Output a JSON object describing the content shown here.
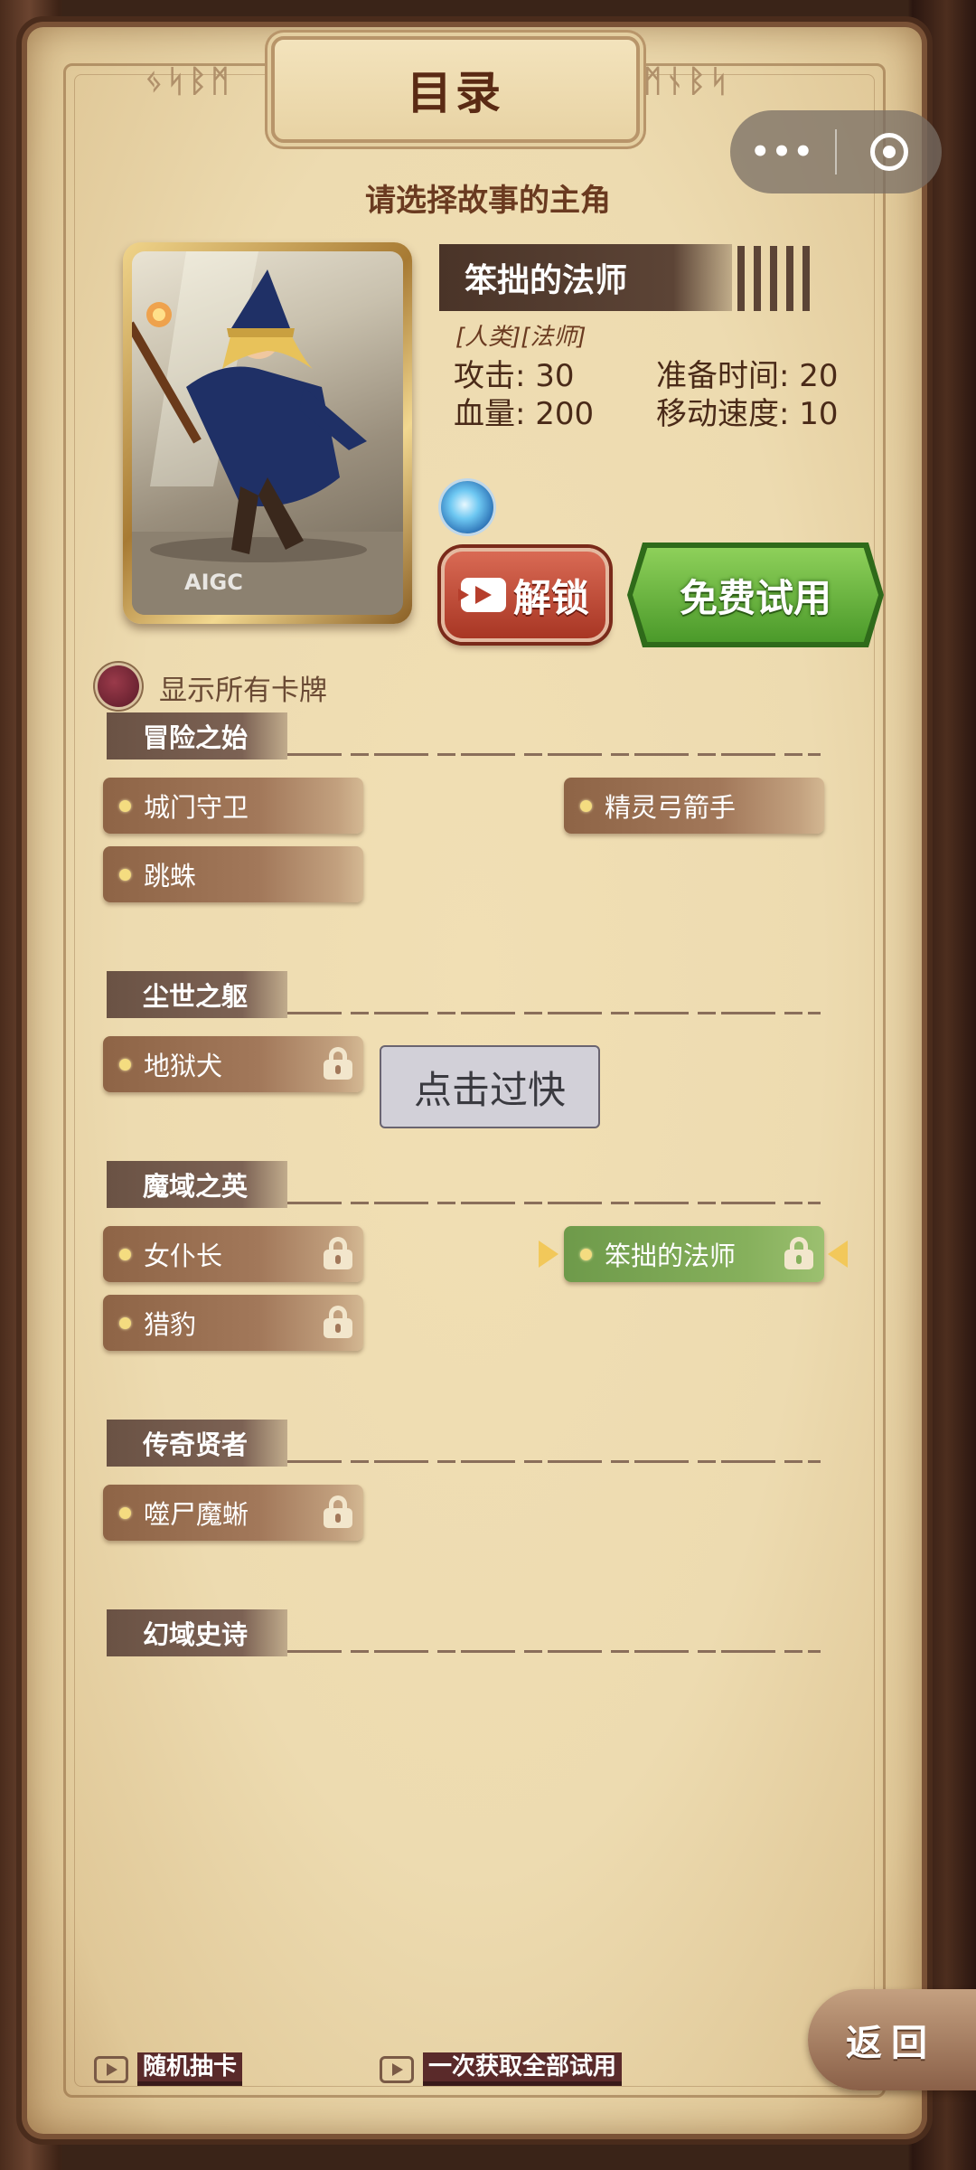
{
  "header": {
    "title": "目录",
    "subtitle": "请选择故事的主角",
    "rune_left": "ᛃᛋᛒᛗ",
    "rune_right": "ᛗᚾᛒᛋ"
  },
  "capsule": {
    "more_icon": "more-dots-icon",
    "close_icon": "target-circle-icon"
  },
  "hero": {
    "name": "笨拙的法师",
    "tags": "[人类][法师]",
    "card_watermark": "AIGC",
    "stats": {
      "attack": "攻击: 30",
      "hp": "血量: 200",
      "prep_time": "准备时间: 20",
      "move_speed": "移动速度: 10"
    }
  },
  "buttons": {
    "unlock": "解锁",
    "free_trial": "免费试用",
    "back": "返回"
  },
  "toggle": {
    "label": "显示所有卡牌",
    "checked": false
  },
  "sections": [
    {
      "title": "冒险之始",
      "items": [
        {
          "label": "城门守卫",
          "locked": false
        },
        {
          "label": "精灵弓箭手",
          "locked": false
        },
        {
          "label": "跳蛛",
          "locked": false
        }
      ]
    },
    {
      "title": "尘世之躯",
      "items": [
        {
          "label": "地狱犬",
          "locked": true
        }
      ]
    },
    {
      "title": "魔域之英",
      "items": [
        {
          "label": "女仆长",
          "locked": true
        },
        {
          "label": "笨拙的法师",
          "locked": true,
          "selected": true
        },
        {
          "label": "猎豹",
          "locked": true
        }
      ]
    },
    {
      "title": "传奇贤者",
      "items": [
        {
          "label": "噬尸魔蜥",
          "locked": true
        }
      ]
    },
    {
      "title": "幻域史诗",
      "items": []
    }
  ],
  "toast": "点击过快",
  "bottom_links": {
    "random_draw": "随机抽卡",
    "get_all_trial": "一次获取全部试用"
  },
  "colors": {
    "parchment": "#eddbb0",
    "item_brown": "#a2785a",
    "item_selected": "#86b05c",
    "unlock_red": "#b63e2c",
    "trial_green": "#6fbf3e"
  }
}
